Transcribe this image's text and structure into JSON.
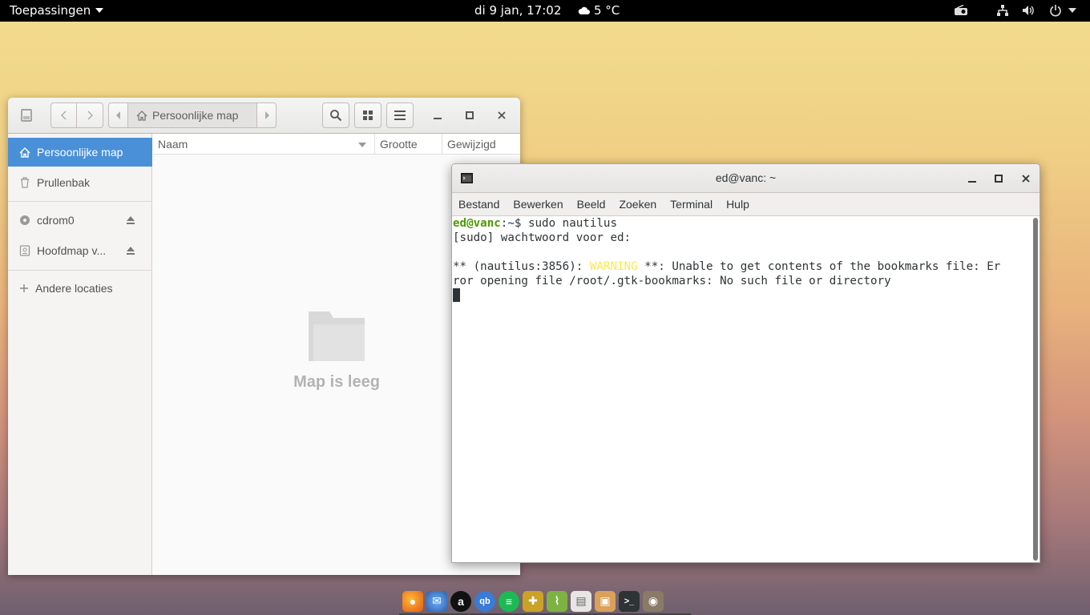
{
  "topbar": {
    "apps_label": "Toepassingen",
    "clock": "di  9 jan, 17:02",
    "weather": "5 °C",
    "tray_icons": [
      "cloud-icon",
      "radio-icon",
      "network-icon",
      "volume-icon",
      "power-icon"
    ]
  },
  "nautilus": {
    "path_label": "Persoonlijke map",
    "columns": {
      "name": "Naam",
      "size": "Grootte",
      "modified": "Gewijzigd"
    },
    "sidebar": {
      "items": [
        {
          "label": "Persoonlijke map",
          "icon": "home-icon"
        },
        {
          "label": "Prullenbak",
          "icon": "trash-icon"
        },
        {
          "label": "cdrom0",
          "icon": "disc-icon"
        },
        {
          "label": "Hoofdmap v...",
          "icon": "drive-icon"
        },
        {
          "label": "Andere locaties",
          "icon": "plus-icon"
        }
      ]
    },
    "empty_text": "Map is leeg"
  },
  "terminal": {
    "title": "ed@vanc: ~",
    "menu": [
      "Bestand",
      "Bewerken",
      "Beeld",
      "Zoeken",
      "Terminal",
      "Hulp"
    ],
    "prompt_user": "ed@vanc",
    "prompt_sep": ":",
    "prompt_path": "~",
    "prompt_cmd": "$ sudo nautilus",
    "line2": "[sudo] wachtwoord voor ed:",
    "line4_pre": "** (nautilus:3856): ",
    "line4_warn": "WARNING",
    "line4_post": " **: Unable to get contents of the bookmarks file: Er",
    "line5": "ror opening file /root/.gtk-bookmarks: No such file or directory"
  },
  "dock": {
    "apps": [
      "firefox-icon",
      "thunderbird-icon",
      "amazon-icon",
      "qbittorrent-icon",
      "spotify-icon",
      "puzzle-icon",
      "rss-icon",
      "files-icon",
      "archive-icon",
      "terminal-icon",
      "gimp-icon"
    ]
  },
  "colors": {
    "selection": "#4a90d9",
    "prompt_user": "#4e9a06",
    "prompt_path": "#3465a4",
    "warning": "#fce94f"
  }
}
